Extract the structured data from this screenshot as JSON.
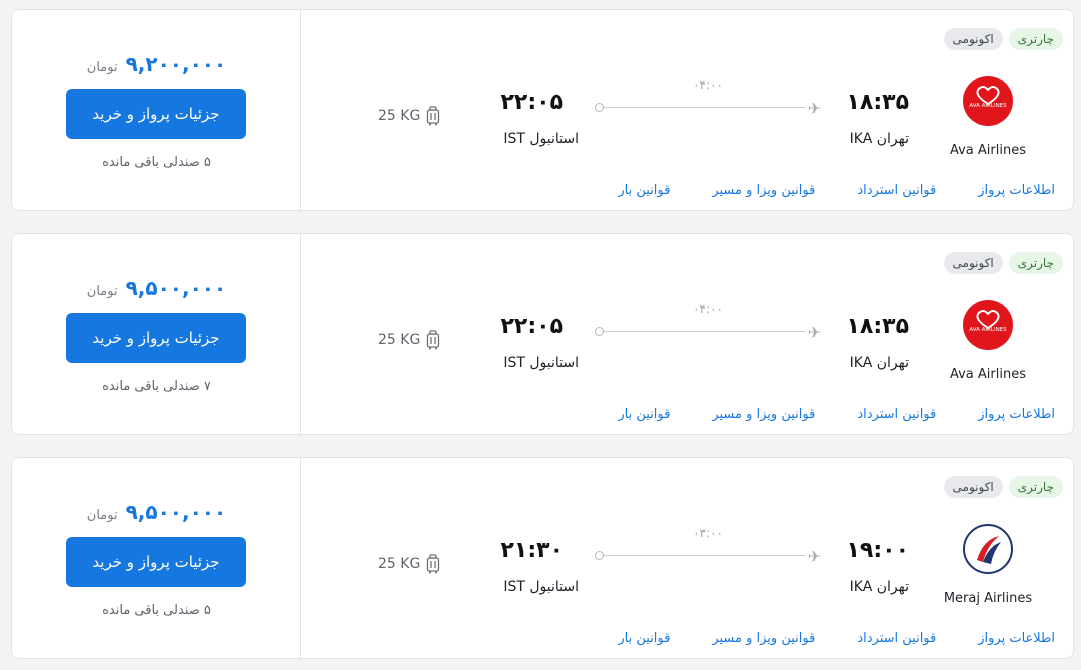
{
  "cards": [
    {
      "price": "۹,۲۰۰,۰۰۰",
      "currency": "تومان",
      "buy_label": "جزئیات پرواز و خرید",
      "seats": "۵ صندلی باقی مانده",
      "tags": [
        "چارتری",
        "اکونومی"
      ],
      "airline_name": "Ava Airlines",
      "airline_logo_text": "AVA AIRLINES",
      "dep_time": "۱۸:۳۵",
      "dep_city": "تهران IKA",
      "arr_time": "۲۲:۰۵",
      "arr_city": "استانبول IST",
      "duration": "۰۴:۰۰",
      "baggage": "25 KG",
      "links": [
        "اطلاعات پرواز",
        "قوانین استرداد",
        "قوانین ویزا و مسیر",
        "قوانین بار"
      ]
    },
    {
      "price": "۹,۵۰۰,۰۰۰",
      "currency": "تومان",
      "buy_label": "جزئیات پرواز و خرید",
      "seats": "۷ صندلی باقی مانده",
      "tags": [
        "چارتری",
        "اکونومی"
      ],
      "airline_name": "Ava Airlines",
      "airline_logo_text": "AVA AIRLINES",
      "dep_time": "۱۸:۳۵",
      "dep_city": "تهران IKA",
      "arr_time": "۲۲:۰۵",
      "arr_city": "استانبول IST",
      "duration": "۰۴:۰۰",
      "baggage": "25 KG",
      "links": [
        "اطلاعات پرواز",
        "قوانین استرداد",
        "قوانین ویزا و مسیر",
        "قوانین بار"
      ]
    },
    {
      "price": "۹,۵۰۰,۰۰۰",
      "currency": "تومان",
      "buy_label": "جزئیات پرواز و خرید",
      "seats": "۵ صندلی باقی مانده",
      "tags": [
        "چارتری",
        "اکونومی"
      ],
      "airline_name": "Meraj Airlines",
      "dep_time": "۱۹:۰۰",
      "dep_city": "تهران IKA",
      "arr_time": "۲۱:۳۰",
      "arr_city": "استانبول IST",
      "duration": "۰۳:۰۰",
      "baggage": "25 KG",
      "links": [
        "اطلاعات پرواز",
        "قوانین استرداد",
        "قوانین ویزا و مسیر",
        "قوانین بار"
      ]
    }
  ],
  "colors": {
    "accent": "#1677e0",
    "charter_tag_bg": "#e8f6ea",
    "charter_tag_text": "#2e7d32",
    "ava_red": "#e1151c",
    "meraj_navy": "#20366f"
  }
}
